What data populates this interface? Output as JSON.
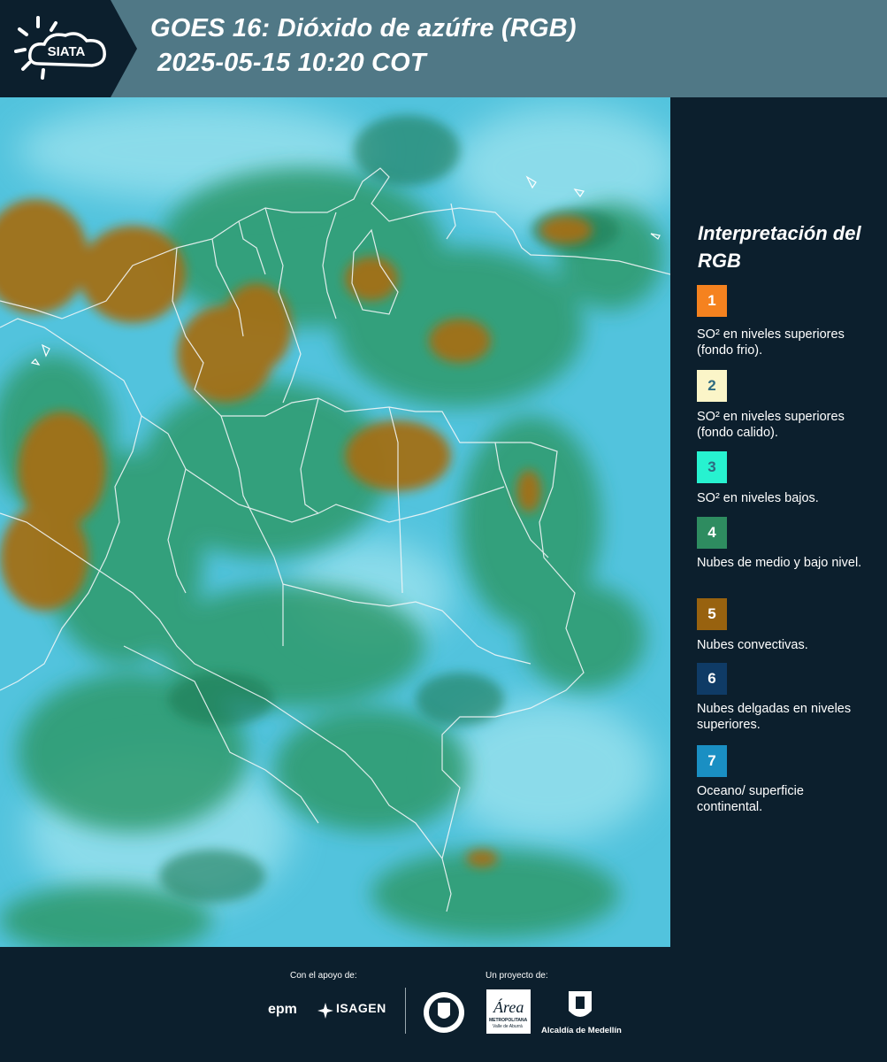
{
  "header": {
    "logo_text": "SIATA",
    "title_line1": "GOES 16: Dióxido de azúfre (RGB)",
    "title_line2": "2025-05-15 10:20 COT"
  },
  "legend": {
    "title": "Interpretación del RGB",
    "items": [
      {
        "num": "1",
        "color": "#f5821f",
        "text": "SO² en niveles superiores (fondo frio)."
      },
      {
        "num": "2",
        "color": "#fbf5c8",
        "text": "SO² en niveles superiores (fondo calido)."
      },
      {
        "num": "3",
        "color": "#27f2d0",
        "text": "SO² en niveles bajos."
      },
      {
        "num": "4",
        "color": "#2e8c60",
        "text": "Nubes de medio y bajo nivel."
      },
      {
        "num": "5",
        "color": "#98620f",
        "text": "Nubes convectivas."
      },
      {
        "num": "6",
        "color": "#0f3b66",
        "text": "Nubes delgadas en niveles superiores."
      },
      {
        "num": "7",
        "color": "#1a8fc3",
        "text": "Oceano/ superficie continental."
      }
    ]
  },
  "footer": {
    "support_label": "Con el apoyo de:",
    "project_label": "Un proyecto de:",
    "sponsor1": "epm",
    "sponsor2": "ISAGEN",
    "partner1_text": "Área",
    "partner1_sub": "METROPOLITANA",
    "partner1_sub2": "Valle de Aburrá",
    "partner2": "Alcaldía de Medellín"
  },
  "colors": {
    "header_bg": "#507886",
    "panel_bg": "#0c1f2d",
    "cyan_surface": "#4fc2dc",
    "convective_cloud": "#98620f",
    "low_cloud": "#2e8c60"
  }
}
